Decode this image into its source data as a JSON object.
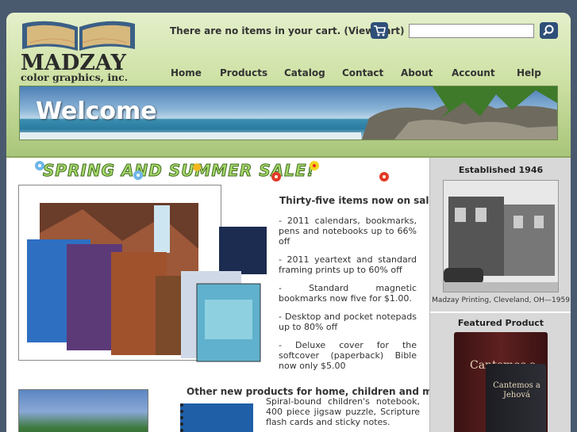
{
  "header": {
    "logo": {
      "name": "MADZAY",
      "sub": "color graphics, inc."
    },
    "cart_text": "There are no items in your cart. (View Cart)",
    "search": {
      "placeholder": ""
    },
    "nav": [
      "Home",
      "Products",
      "Catalog",
      "Contact",
      "About",
      "Account",
      "Help"
    ],
    "banner_title": "Welcome"
  },
  "main": {
    "sale_title": "SPRING AND SUMMER SALE!",
    "sale_heading": "Thirty-five items now on sale!",
    "sale_items": [
      "- 2011 calendars, bookmarks, pens and notebooks up to 66% off",
      "- 2011 yeartext and standard framing prints up to 60% off",
      "- Standard magnetic bookmarks now five for $1.00.",
      "- Desktop and pocket notepads up to 80% off",
      "- Deluxe cover for the softcover (paperback) Bible now only $5.00"
    ],
    "other_heading": "Other new products for home, children and ministry",
    "other_text": "Spiral-bound children's notebook, 400 piece jigsaw puzzle, Scripture flash cards and sticky notes."
  },
  "sidebar": {
    "established": "Established 1946",
    "photo_caption": "Madzay Printing, Cleveland, OH—1959",
    "featured": "Featured Product",
    "product_title_1": "Cantemos a",
    "product_title_2": "Cantemos a Jehová"
  },
  "colors": {
    "page_bg": "#4a5a6e",
    "header_green": "#cfe2a6",
    "button_blue": "#2f4f79",
    "sidebar_gray": "#d8d8d8"
  }
}
